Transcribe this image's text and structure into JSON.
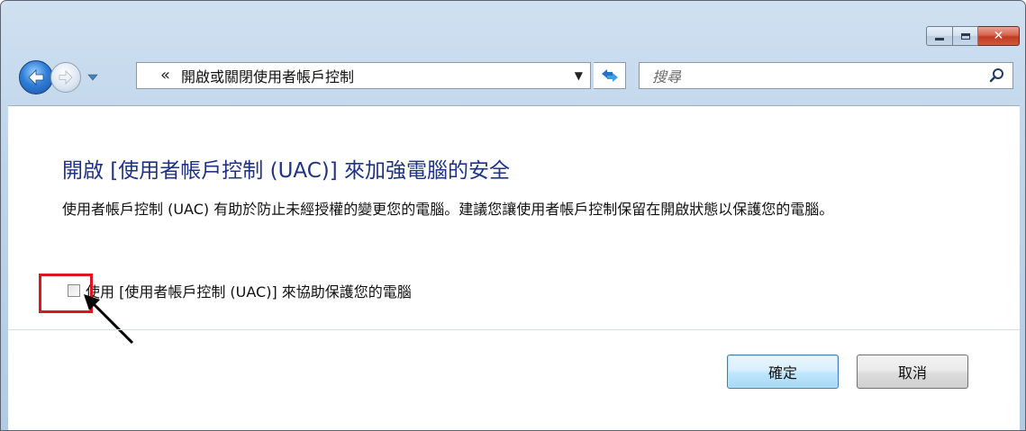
{
  "window": {
    "caption_buttons": {
      "minimize": "minimize-icon",
      "maximize": "maximize-icon",
      "close": "close-icon"
    }
  },
  "navbar": {
    "breadcrumb_chevron": "«",
    "address_text": "開啟或關閉使用者帳戶控制",
    "search_placeholder": "搜尋"
  },
  "content": {
    "heading": "開啟 [使用者帳戶控制 (UAC)] 來加強電腦的安全",
    "description": "使用者帳戶控制 (UAC) 有助於防止未經授權的變更您的電腦。建議您讓使用者帳戶控制保留在開啟狀態以保護您的電腦。",
    "uac_checkbox": {
      "label": "使用 [使用者帳戶控制 (UAC)] 來協助保護您的電腦",
      "checked": false
    }
  },
  "buttons": {
    "ok_label": "確定",
    "cancel_label": "取消"
  },
  "colors": {
    "heading": "#1e3287",
    "highlight": "#e0141c",
    "titlebar": "#bed4ea"
  }
}
